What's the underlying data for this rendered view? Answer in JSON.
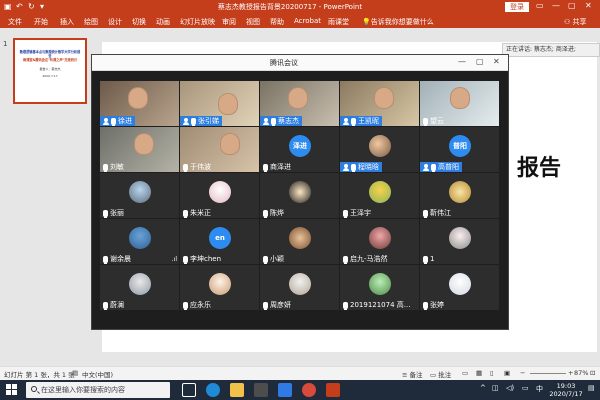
{
  "app": {
    "title": "蔡志杰教授报告背景20200717 - PowerPoint",
    "login": "登录",
    "window_controls": {
      "minimize": "—",
      "restore": "▢",
      "close": "✕"
    }
  },
  "ribbon": {
    "tabs": [
      "文件",
      "开始",
      "插入",
      "绘图",
      "设计",
      "切换",
      "动画",
      "幻灯片放映",
      "审阅",
      "视图",
      "帮助",
      "Acrobat",
      "雨课堂"
    ],
    "tell_me": "告诉我你想要做什么",
    "share": "共享"
  },
  "thumbnail": {
    "number": "1",
    "line1": "数理逻辑基本点与数理统计数学大学分析报告",
    "line2": "雨课堂&腾讯会议\"听课之声\"交流研讨",
    "line3": "报告人：蔡志杰",
    "line4": "2020.7.17"
  },
  "slide": {
    "visible_text": "报告"
  },
  "speaker_label": "正在讲话: 蔡志杰; 商泽进;",
  "meeting": {
    "title": "腾讯会议",
    "window_controls": {
      "minimize": "—",
      "restore": "▢",
      "close": "✕"
    },
    "participants": [
      {
        "name": "徐进",
        "bar": "blue",
        "icon": "person",
        "mic": true
      },
      {
        "name": "张引娣",
        "bar": "blue",
        "icon": "person",
        "mic": true
      },
      {
        "name": "蔡志杰",
        "bar": "blue",
        "icon": "person",
        "mic": true
      },
      {
        "name": "王凯昵",
        "bar": "blue",
        "icon": "person",
        "mic": true
      },
      {
        "name": "望云",
        "bar": "plain",
        "icon": "mic"
      },
      {
        "name": "刘敏",
        "bar": "plain",
        "icon": "mic"
      },
      {
        "name": "于伟波",
        "bar": "plain",
        "icon": "mic"
      },
      {
        "name": "商泽进",
        "bar": "plain",
        "icon": "mic",
        "avatar_text": "泽进"
      },
      {
        "name": "程晓晗",
        "bar": "blue",
        "icon": "person",
        "mic": true
      },
      {
        "name": "高普阳",
        "bar": "blue",
        "icon": "person",
        "mic": true,
        "avatar_text": "普阳"
      },
      {
        "name": "张丽",
        "bar": "plain",
        "icon": "mic"
      },
      {
        "name": "朱米正",
        "bar": "plain",
        "icon": "mic"
      },
      {
        "name": "陈烨",
        "bar": "plain",
        "icon": "mic"
      },
      {
        "name": "王泽宇",
        "bar": "plain",
        "icon": "mic"
      },
      {
        "name": "靳伟江",
        "bar": "plain",
        "icon": "mic"
      },
      {
        "name": "谢余晨",
        "bar": "plain",
        "icon": "mic",
        "signal": ".ıl"
      },
      {
        "name": "李坤chen",
        "bar": "plain",
        "icon": "mic",
        "avatar_text": "en"
      },
      {
        "name": "小颖",
        "bar": "plain",
        "icon": "mic"
      },
      {
        "name": "启九-马浩然",
        "bar": "plain",
        "icon": "mic"
      },
      {
        "name": "1",
        "bar": "plain",
        "icon": "mic"
      },
      {
        "name": "蔚澜",
        "bar": "plain",
        "icon": "mic"
      },
      {
        "name": "应永乐",
        "bar": "plain",
        "icon": "mic"
      },
      {
        "name": "周彦妍",
        "bar": "plain",
        "icon": "mic"
      },
      {
        "name": "2019121074 高...",
        "bar": "plain",
        "icon": "mic"
      },
      {
        "name": "张婷",
        "bar": "plain",
        "icon": "mic"
      }
    ]
  },
  "statusbar": {
    "slide_info": "幻灯片 第 1 张，共 1 张",
    "language": "中文(中国)",
    "notes": "备注",
    "comments": "批注",
    "zoom": "87%"
  },
  "taskbar": {
    "search_placeholder": "在这里输入你要搜索的内容",
    "time": "19:03",
    "date": "2020/7/17",
    "ime": "中"
  }
}
